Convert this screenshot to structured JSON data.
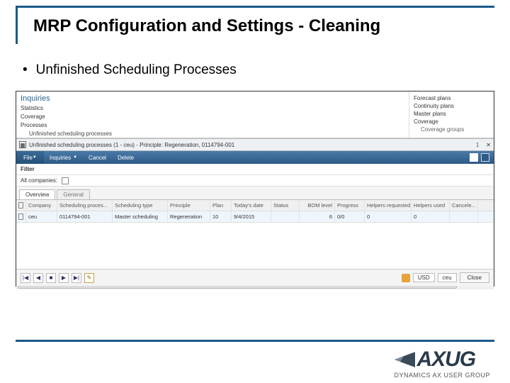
{
  "slide": {
    "title": "MRP Configuration and Settings - Cleaning",
    "bullet": "Unfinished Scheduling Processes"
  },
  "nav_left": {
    "header": "Inquiries",
    "items": [
      "Statistics",
      "Coverage",
      "Processes"
    ],
    "sub_item": "Unfinished scheduling processes"
  },
  "nav_right": {
    "items": [
      "Forecast plans",
      "Continuity plans",
      "Master plans"
    ],
    "coverage": "Coverage",
    "coverage_sub": "Coverage groups"
  },
  "window": {
    "title": "Unfinished scheduling processes (1 - ceu) - Principle: Regeneration, 0114794-001",
    "count": "1",
    "close": "✕"
  },
  "menu": {
    "file": "File",
    "inquiries": "Inquiries",
    "cancel": "Cancel",
    "delete": "Delete"
  },
  "filter": {
    "label": "Filter",
    "all_companies": "All companies:"
  },
  "tabs": {
    "overview": "Overview",
    "general": "General"
  },
  "grid": {
    "headers": [
      "Company",
      "Scheduling proces...",
      "Scheduling type",
      "Principle",
      "Plan",
      "Today's date",
      "Status",
      "BOM level",
      "Progress",
      "Helpers requested",
      "Helpers used",
      "Cancele..."
    ],
    "row": {
      "company": "ceu",
      "process": "0114794-001",
      "type": "Master scheduling",
      "principle": "Regeneration",
      "plan": "10",
      "date": "9/4/2015",
      "status": "",
      "bom": "6",
      "progress": "0/0",
      "hreq": "0",
      "hused": "0",
      "cancel": ""
    }
  },
  "status_bar": {
    "first": "|◀",
    "prev": "◀",
    "stop": "■",
    "next": "▶",
    "last": "▶|",
    "edit": "✎",
    "currency": "USD",
    "company": "ceu",
    "close": "Close"
  },
  "logo": {
    "brand": "AXUG",
    "sub": "DYNAMICS AX USER GROUP"
  }
}
